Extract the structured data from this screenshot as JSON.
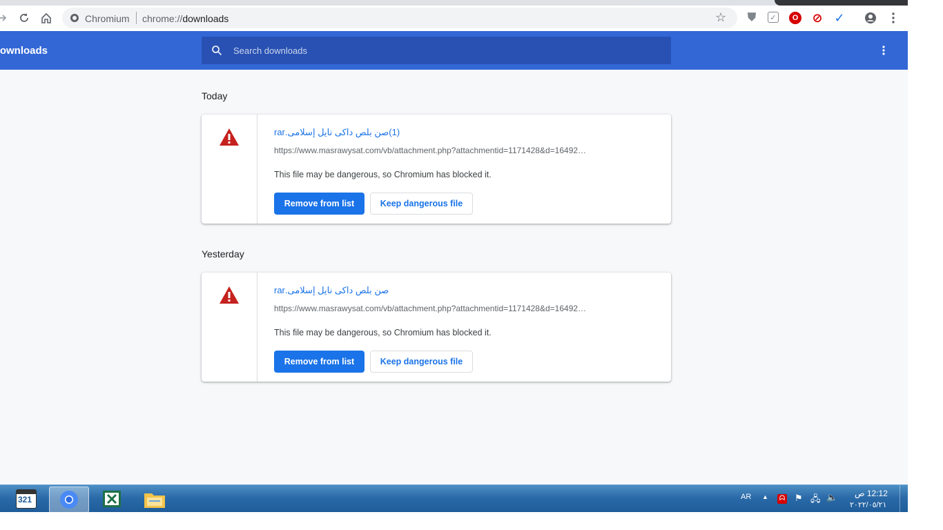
{
  "browser": {
    "site_name": "Chromium",
    "url_scheme": "chrome://",
    "url_host": "downloads",
    "extensions": [
      {
        "icon": "shield-extension-icon",
        "color": "#80868b"
      },
      {
        "icon": "puzzle-extension-icon",
        "color": "#80868b"
      },
      {
        "icon": "opera-extension-icon",
        "color": "#d50000"
      },
      {
        "icon": "block-extension-icon",
        "color": "#d50000"
      },
      {
        "icon": "check-extension-icon",
        "color": "#1a73e8"
      }
    ]
  },
  "header": {
    "title": "Downloads",
    "search_placeholder": "Search downloads"
  },
  "sections": [
    {
      "label": "Today",
      "item": {
        "filename": "(1)صن بلص داكى نايل إسلامى.rar",
        "url": "https://www.masrawysat.com/vb/attachment.php?attachmentid=1171428&d=16492…",
        "description": "This file may be dangerous, so Chromium has blocked it.",
        "remove_label": "Remove from list",
        "keep_label": "Keep dangerous file"
      }
    },
    {
      "label": "Yesterday",
      "item": {
        "filename": "صن بلص داكى نايل إسلامى.rar",
        "url": "https://www.masrawysat.com/vb/attachment.php?attachmentid=1171428&d=16492…",
        "description": "This file may be dangerous, so Chromium has blocked it.",
        "remove_label": "Remove from list",
        "keep_label": "Keep dangerous file"
      }
    }
  ],
  "taskbar": {
    "apps": [
      {
        "name": "media-player-classic",
        "label": "321"
      },
      {
        "name": "chromium",
        "active": true
      },
      {
        "name": "excel"
      },
      {
        "name": "file-explorer"
      }
    ],
    "language": "AR",
    "time": "12:12 ص",
    "date": "٢٠٢٢/٠٥/٢١"
  },
  "colors": {
    "accent": "#3367d6",
    "search_bg": "#2851b3",
    "button_primary": "#1a73e8",
    "warning": "#c5221f"
  }
}
